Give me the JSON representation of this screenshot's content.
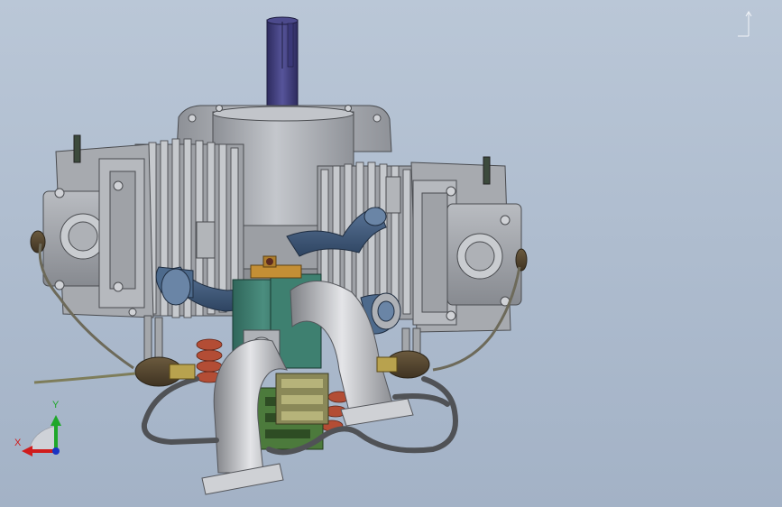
{
  "viewport": {
    "description_name": "cad-graphics-area",
    "background_top": "#bac7d7",
    "background_bottom": "#a3b2c6"
  },
  "triad": {
    "x_label": "X",
    "y_label": "Y",
    "x_color": "#d01c1c",
    "y_color": "#1fa72a",
    "z_color": "#1a34c4"
  },
  "model": {
    "shaft_color": "#3c3a79",
    "body_color": "#a5a8ad",
    "intake_color": "#3d5575",
    "carburetor_color": "#3b7a6c",
    "spring_color": "#b34d35",
    "pcb_color": "#4c7a3c"
  }
}
